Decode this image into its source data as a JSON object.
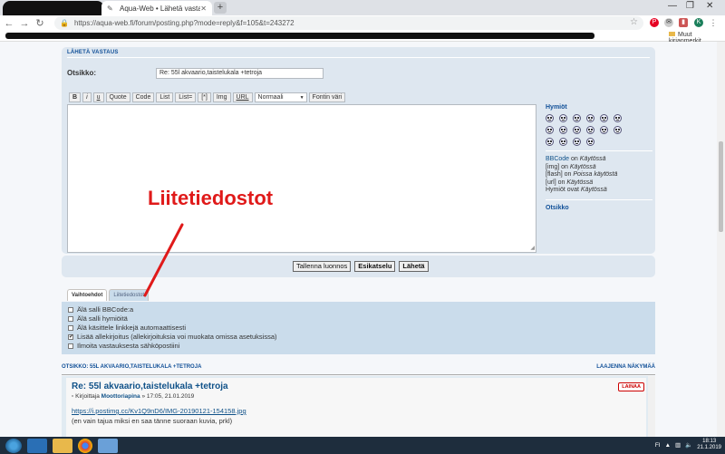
{
  "browser": {
    "active_tab_title": "Aqua-Web • Lähetä vastaus",
    "url": "https://aqua-web.fi/forum/posting.php?mode=reply&f=105&t=243272",
    "other_bookmarks": "Muut kirjanmerkit",
    "profile_initial": "K"
  },
  "form": {
    "panel_title": "LÄHETÄ VASTAUS",
    "subject_label": "Otsikko:",
    "subject_value": "Re: 55l akvaario,taistelukala +tetroja",
    "bbcode_buttons": [
      "B",
      "i",
      "u",
      "Quote",
      "Code",
      "List",
      "List=",
      "[*]",
      "Img",
      "URL"
    ],
    "font_size_value": "Normaali",
    "font_color_button": "Fontin väri"
  },
  "sidebar": {
    "smilies_title": "Hymiöt",
    "bbcode_link": "BBCode",
    "bbcode_on": "on",
    "bbcode_status": "Käytössä",
    "img_label": "[img] on",
    "img_status": "Käytössä",
    "flash_label": "[flash] on",
    "flash_status": "Poissa käytöstä",
    "url_label": "[url] on",
    "url_status": "Käytössä",
    "smilies_label": "Hymiöt ovat",
    "smilies_status": "Käytössä",
    "subject_heading": "Otsikko"
  },
  "submit": {
    "save_draft": "Tallenna luonnos",
    "preview": "Esikatselu",
    "send": "Lähetä"
  },
  "tabs": {
    "options": "Vaihtoehdot",
    "attachments": "Liitetiedostot"
  },
  "options": [
    {
      "label": "Älä salli BBCode:a",
      "checked": false
    },
    {
      "label": "Älä salli hymiöitä",
      "checked": false
    },
    {
      "label": "Älä käsittele linkkejä automaattisesti",
      "checked": false
    },
    {
      "label": "Lisää allekirjoitus (allekirjoituksia voi muokata omissa asetuksissa)",
      "checked": true
    },
    {
      "label": "Ilmoita vastauksesta sähköpostiini",
      "checked": false
    }
  ],
  "review": {
    "heading": "OTSIKKO: 55L AKVAARIO,TAISTELUKALA +TETROJA",
    "expand": "LAAJENNA NÄKYMÄÄ",
    "post_title": "Re: 55l akvaario,taistelukala +tetroja",
    "meta_prefix": "Kirjoittaja",
    "author": "Moottoriapina",
    "meta_suffix": "» 17:05, 21.01.2019",
    "quote_button": "LAINAA",
    "link": "https://i.postimg.cc/Kv1Q9nD6/IMG-20190121-154158.jpg",
    "body": "(en vain tajua miksi en saa tänne suoraan kuvia, prkl)"
  },
  "annotation": {
    "text": "Liitetiedostot",
    "color": "#e01a1a"
  },
  "taskbar": {
    "lang": "FI",
    "time": "18:13",
    "date": "21.1.2019"
  }
}
